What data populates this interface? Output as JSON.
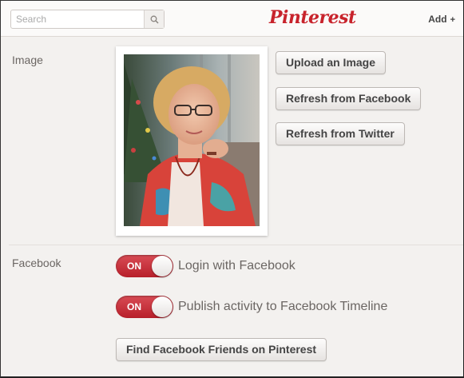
{
  "header": {
    "search_placeholder": "Search",
    "logo_text": "Pinterest",
    "add_label": "Add",
    "add_plus": "+"
  },
  "image_section": {
    "label": "Image",
    "buttons": {
      "upload": "Upload an Image",
      "refresh_facebook": "Refresh from Facebook",
      "refresh_twitter": "Refresh from Twitter"
    }
  },
  "facebook_section": {
    "label": "Facebook",
    "toggles": [
      {
        "state": "ON",
        "label": "Login with Facebook"
      },
      {
        "state": "ON",
        "label": "Publish activity to Facebook Timeline"
      }
    ],
    "find_friends_button": "Find Facebook Friends on Pinterest"
  },
  "colors": {
    "brand_red": "#c8232c",
    "toggle_on": "#c22a33",
    "background": "#f3f1ef"
  },
  "icons": {
    "search": "search-icon",
    "add": "plus-icon"
  }
}
